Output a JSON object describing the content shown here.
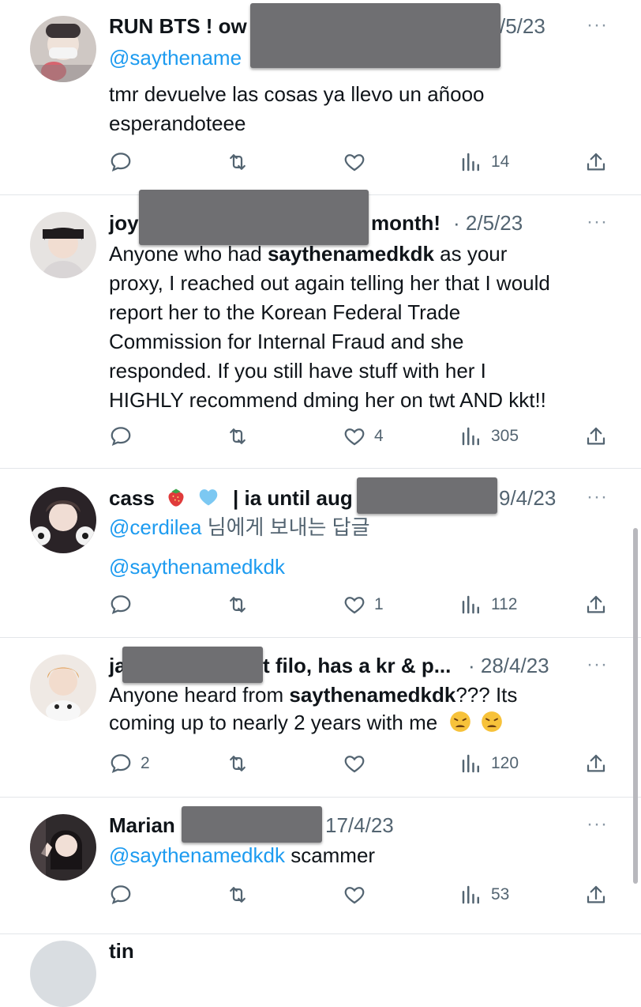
{
  "tweets": [
    {
      "name": "RUN BTS ! ow",
      "handle": "@saythename",
      "date": "/5/23",
      "more": "···",
      "text_line1": "tmr devuelve las cosas ya llevo un añooo",
      "text_line2": "esperandoteee",
      "likes": "",
      "replies": "",
      "views": "14"
    },
    {
      "name": "joy",
      "name_tail": "month!",
      "date": "· 2/5/23",
      "more": "···",
      "text_part1": "Anyone who had ",
      "text_mention": "saythenamedkdk",
      "text_part2": " as your",
      "text_line2": "proxy, I reached out again telling her that I would",
      "text_line3": "report her to the Korean Federal  Trade",
      "text_line4": "Commission for Internal Fraud and she",
      "text_line5": "responded. If you still have stuff with her I",
      "text_line6": "HIGHLY recommend dming her on twt AND kkt!!",
      "likes": "4",
      "views": "305"
    },
    {
      "name": "cass",
      "name_tail": "| ia until aug",
      "date": "9/4/23",
      "more": "···",
      "reply_to": "@cerdilea",
      "reply_suffix": " 님에게 보내는 답글",
      "text_mention": "@saythenamedkdk",
      "likes": "1",
      "views": "112"
    },
    {
      "name": "ja",
      "name_tail": "t filo, has a kr & p...",
      "date": "· 28/4/23",
      "more": "···",
      "text_part1": "Anyone heard from ",
      "text_mention": "saythenamedkdk",
      "text_part2": "??? Its",
      "text_line2": "coming up to nearly 2 years with me",
      "replies": "2",
      "views": "120"
    },
    {
      "name": "Marian",
      "date": "17/4/23",
      "more": "···",
      "text_mention": "@saythenamedkdk",
      "text_part2": " scammer",
      "views": "53"
    }
  ],
  "partial_text": "tin",
  "colors": {
    "mention": "#1d9bf0",
    "meta": "#536471",
    "divider": "#e3e6e9",
    "redaction": "#6f6f72"
  },
  "icons": [
    "reply-icon",
    "retweet-icon",
    "like-icon",
    "views-icon",
    "share-icon",
    "more-icon",
    "strawberry-emoji",
    "blue-heart-emoji",
    "weary-face-emoji"
  ]
}
